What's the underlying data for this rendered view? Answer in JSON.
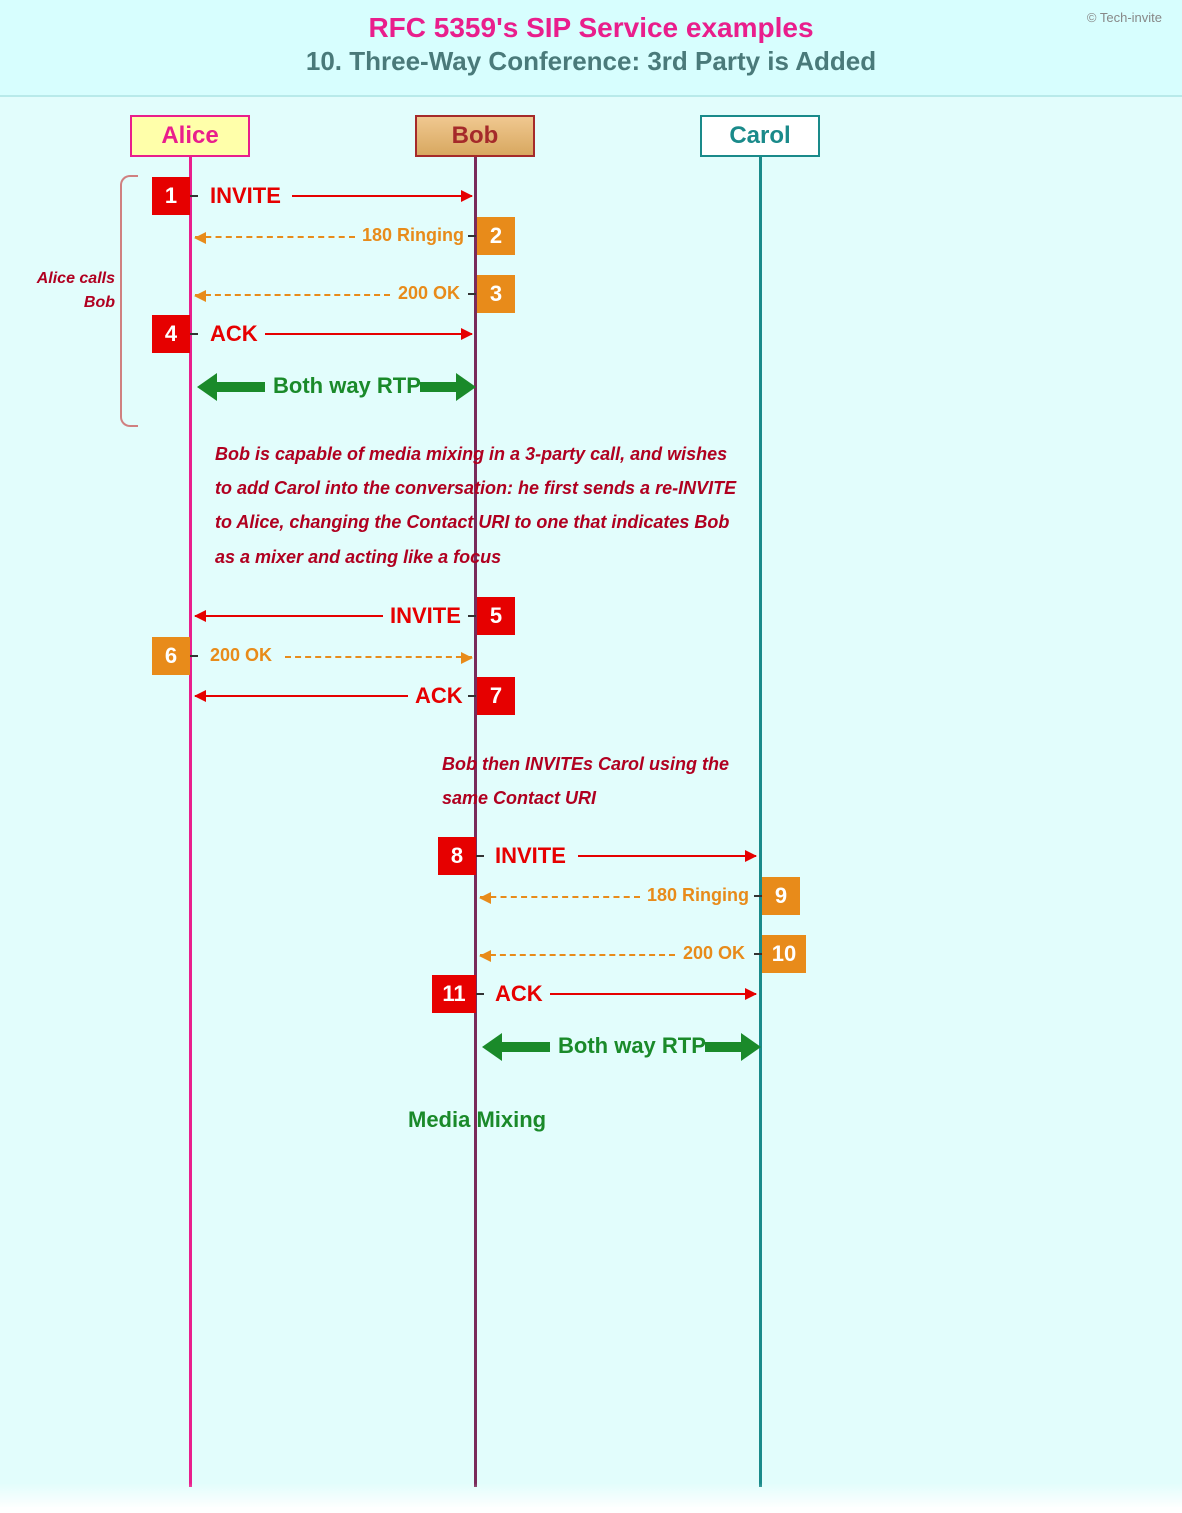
{
  "header": {
    "copyright": "© Tech-invite",
    "title1": "RFC 5359's SIP Service examples",
    "title2": "10. Three-Way Conference: 3rd Party is Added"
  },
  "actors": {
    "alice": "Alice",
    "bob": "Bob",
    "carol": "Carol"
  },
  "side_note": "Alice calls Bob",
  "steps": {
    "s1": {
      "num": "1",
      "label": "INVITE"
    },
    "s2": {
      "num": "2",
      "label": "180 Ringing"
    },
    "s3": {
      "num": "3",
      "label": "200 OK"
    },
    "s4": {
      "num": "4",
      "label": "ACK"
    },
    "s5": {
      "num": "5",
      "label": "INVITE"
    },
    "s6": {
      "num": "6",
      "label": "200 OK"
    },
    "s7": {
      "num": "7",
      "label": "ACK"
    },
    "s8": {
      "num": "8",
      "label": "INVITE"
    },
    "s9": {
      "num": "9",
      "label": "180 Ringing"
    },
    "s10": {
      "num": "10",
      "label": "200 OK"
    },
    "s11": {
      "num": "11",
      "label": "ACK"
    }
  },
  "rtp": {
    "label1": "Both way RTP",
    "label2": "Both way RTP"
  },
  "notes": {
    "n1": "Bob is capable of media mixing in a 3-party call, and wishes to add Carol into the conversation: he first sends a re-INVITE to Alice, changing the Contact URI to one that indicates Bob as a mixer and acting like a focus",
    "n2": "Bob then INVITEs Carol using the same Contact URI"
  },
  "media_mixing": "Media Mixing"
}
